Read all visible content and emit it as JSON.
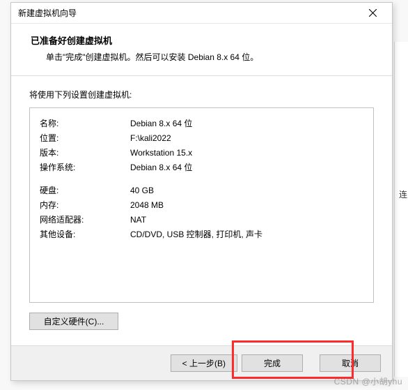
{
  "window": {
    "title": "新建虚拟机向导"
  },
  "header": {
    "heading": "已准备好创建虚拟机",
    "subheading": "单击\"完成\"创建虚拟机。然后可以安装 Debian 8.x 64 位。"
  },
  "body": {
    "label": "将使用下列设置创建虚拟机:",
    "rows_a": [
      {
        "k": "名称:",
        "v": "Debian 8.x 64 位"
      },
      {
        "k": "位置:",
        "v": "F:\\kali2022"
      },
      {
        "k": "版本:",
        "v": "Workstation 15.x"
      },
      {
        "k": "操作系统:",
        "v": "Debian 8.x 64 位"
      }
    ],
    "rows_b": [
      {
        "k": "硬盘:",
        "v": "40 GB"
      },
      {
        "k": "内存:",
        "v": "2048 MB"
      },
      {
        "k": "网络适配器:",
        "v": "NAT"
      },
      {
        "k": "其他设备:",
        "v": "CD/DVD, USB 控制器, 打印机, 声卡"
      }
    ],
    "customize_label": "自定义硬件(C)..."
  },
  "footer": {
    "back": "< 上一步(B)",
    "finish": "完成",
    "cancel": "取消"
  },
  "background": {
    "partial_text": "连"
  },
  "watermark": "CSDN @小胡yhu"
}
